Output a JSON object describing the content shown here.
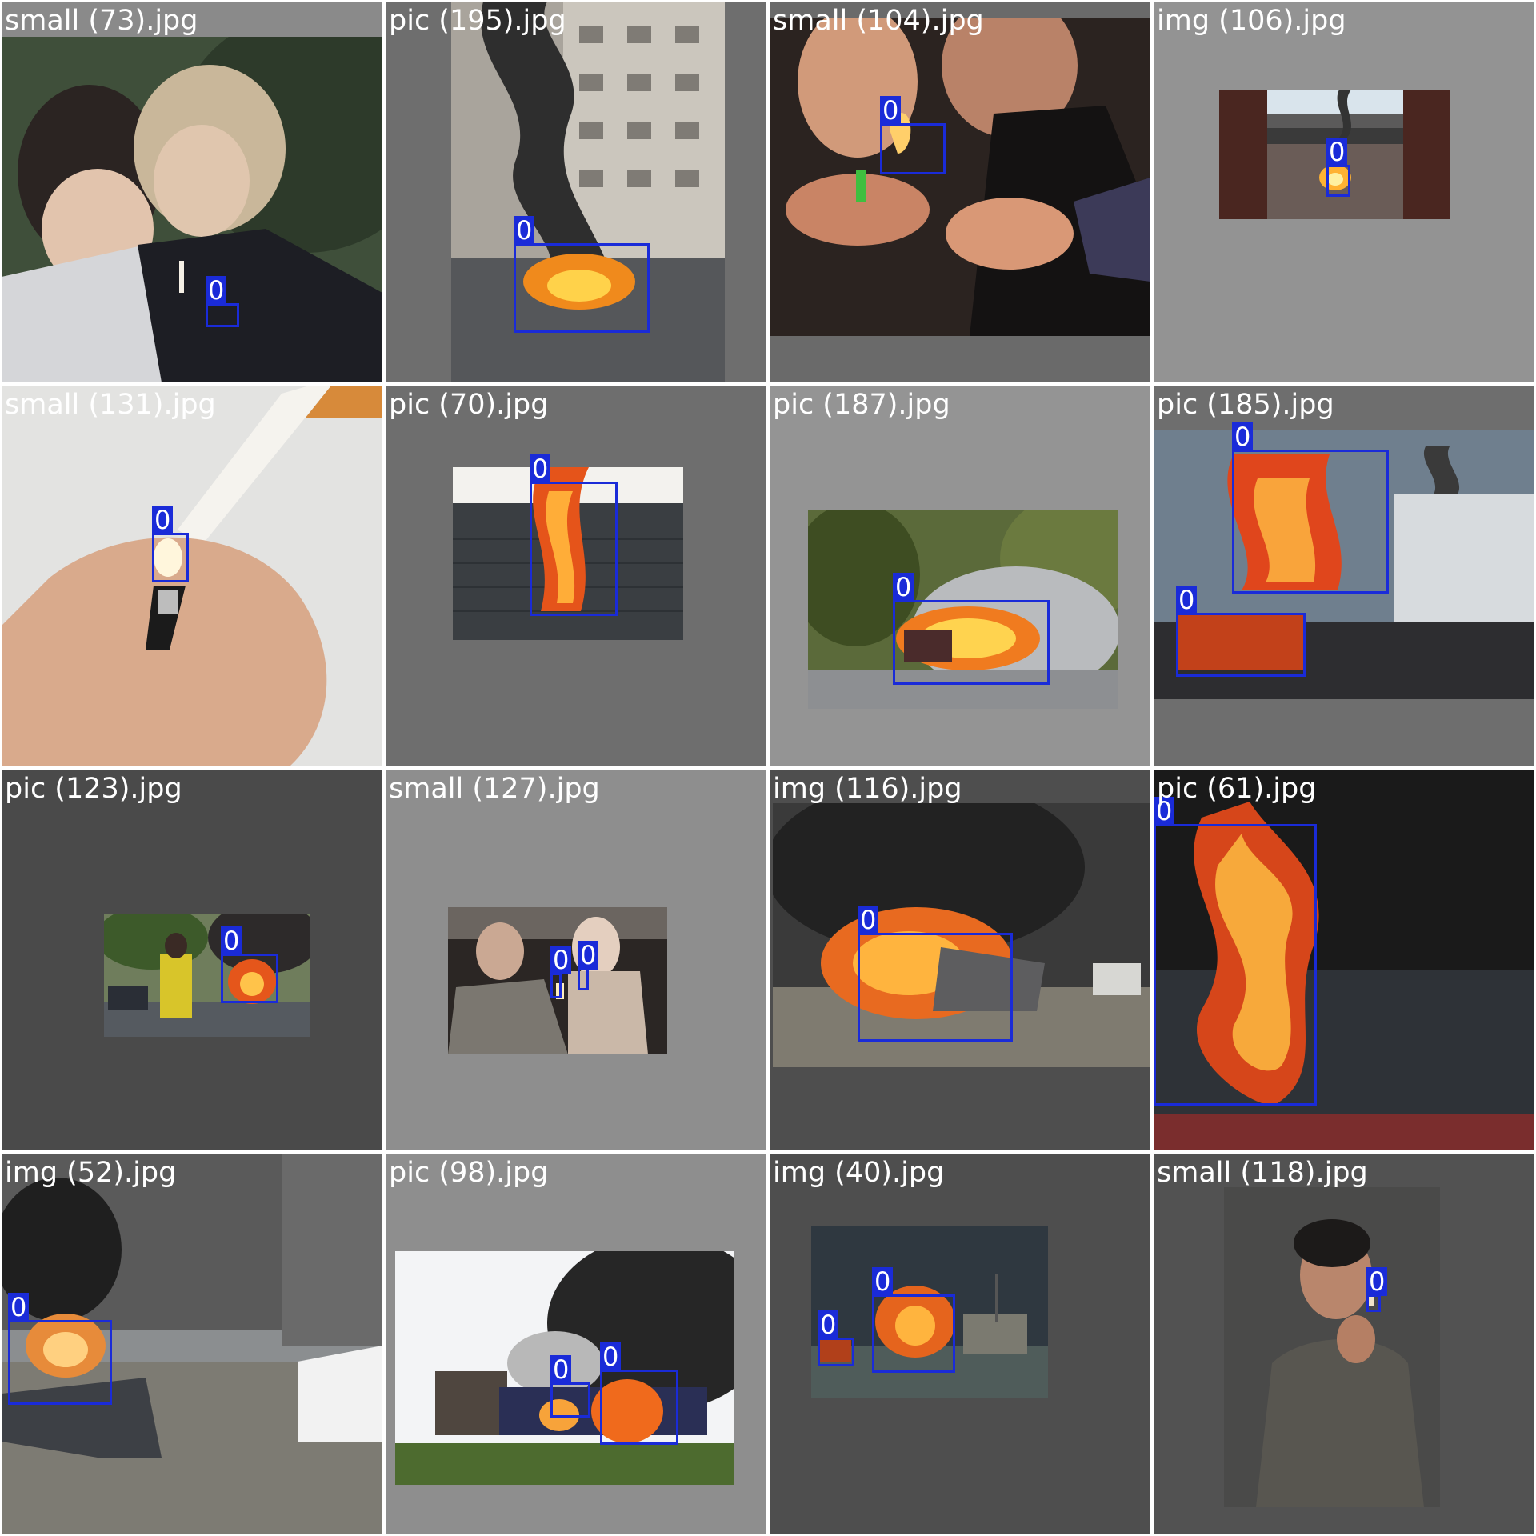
{
  "mosaic": {
    "tiles": [
      {
        "file_name": "small (73).jpg",
        "pad": "#8a8a8a",
        "scene": "smoking",
        "detections": [
          "0"
        ]
      },
      {
        "file_name": "pic (195).jpg",
        "pad": "#6e6e6e",
        "scene": "car-fire-street",
        "detections": [
          "0"
        ]
      },
      {
        "file_name": "small (104).jpg",
        "pad": "#6a6a6a",
        "scene": "lighter-party",
        "detections": [
          "0"
        ]
      },
      {
        "file_name": "img (106).jpg",
        "pad": "#939393",
        "scene": "bridge-fire",
        "detections": [
          "0"
        ]
      },
      {
        "file_name": "small (131).jpg",
        "pad": "#8a8a8a",
        "scene": "cigarette-lighter",
        "detections": [
          "0"
        ]
      },
      {
        "file_name": "pic (70).jpg",
        "pad": "#6e6e6e",
        "scene": "window-fire",
        "detections": [
          "0"
        ]
      },
      {
        "file_name": "pic (187).jpg",
        "pad": "#949494",
        "scene": "car-fire-trees",
        "detections": [
          "0"
        ]
      },
      {
        "file_name": "pic (185).jpg",
        "pad": "#6e6e6e",
        "scene": "building-fire",
        "detections": [
          "0",
          "0"
        ]
      },
      {
        "file_name": "pic (123).jpg",
        "pad": "#4a4a4a",
        "scene": "street-fire-person",
        "detections": [
          "0"
        ]
      },
      {
        "file_name": "small (127).jpg",
        "pad": "#8e8e8e",
        "scene": "couple-lighter",
        "detections": [
          "0",
          "0"
        ]
      },
      {
        "file_name": "img (116).jpg",
        "pad": "#4e4e4e",
        "scene": "burning-car-smoke",
        "detections": [
          "0"
        ]
      },
      {
        "file_name": "pic (61).jpg",
        "pad": "#2a2a2a",
        "scene": "large-blaze",
        "detections": [
          "0"
        ]
      },
      {
        "file_name": "img (52).jpg",
        "pad": "#8a8a8a",
        "scene": "flooded-street-fire",
        "detections": [
          "0"
        ]
      },
      {
        "file_name": "pic (98).jpg",
        "pad": "#8e8e8e",
        "scene": "bus-fire",
        "detections": [
          "0",
          "0"
        ]
      },
      {
        "file_name": "img (40).jpg",
        "pad": "#4e4e4e",
        "scene": "tank-fire",
        "detections": [
          "0",
          "0"
        ]
      },
      {
        "file_name": "small (118).jpg",
        "pad": "#525252",
        "scene": "man-smoking",
        "detections": [
          "0"
        ]
      }
    ]
  },
  "colors": {
    "box": "#1a2bd8",
    "label_text": "#ffffff",
    "grid_gap": "#ffffff"
  }
}
